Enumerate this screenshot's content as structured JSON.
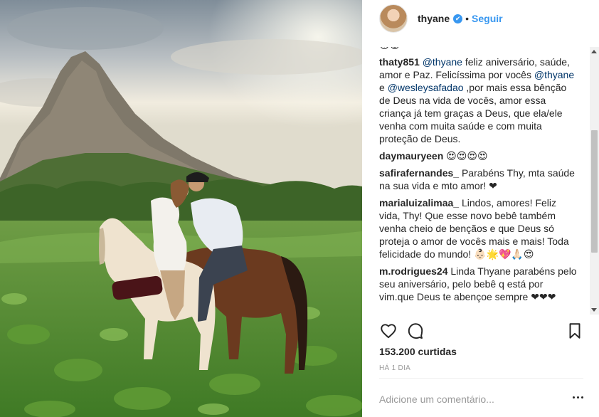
{
  "post": {
    "username": "thyane",
    "follow_label": "Seguir",
    "separator": "•",
    "verified_icon": "✔"
  },
  "comments": [
    {
      "type": "emoji",
      "text": "😘😍"
    },
    {
      "type": "comment",
      "user": "thaty851",
      "parts": [
        {
          "mention": "@thyane"
        },
        {
          "text": " feliz aniversário, saúde, amor e Paz. Felicíssima por vocês "
        },
        {
          "mention": "@thyane"
        },
        {
          "text": " e "
        },
        {
          "mention": "@wesleysafadao"
        },
        {
          "text": " ,por mais essa bênção de Deus na vida de vocês, amor essa criança já tem graças a Deus, que ela/ele venha com muita saúde e com muita proteção de Deus."
        }
      ]
    },
    {
      "type": "comment",
      "user": "daymauryeen",
      "parts": [
        {
          "text": "😍😍😍😍"
        }
      ]
    },
    {
      "type": "comment",
      "user": "safirafernandes_",
      "parts": [
        {
          "text": "Parabéns Thy, mta saúde na sua vida e mto amor! ❤"
        }
      ]
    },
    {
      "type": "comment",
      "user": "marialuizalimaa_",
      "parts": [
        {
          "text": "Lindos, amores! Feliz vida, Thy! Que esse novo bebê também venha cheio de bençãos e que Deus só proteja o amor de vocês mais e mais! Toda felicidade do mundo! 👶🏻🌟💖🙏🏻😍"
        }
      ]
    },
    {
      "type": "comment",
      "user": "m.rodrigues24",
      "parts": [
        {
          "text": "Linda Thyane parabéns pelo seu aniversário, pelo bebê q está por vim.que Deus te abençoe sempre ❤❤❤"
        }
      ]
    }
  ],
  "stats": {
    "likes": "153.200 curtidas",
    "time": "HÁ 1 DIA"
  },
  "composer": {
    "placeholder": "Adicione um comentário..."
  },
  "icons": {
    "like": "heart-icon",
    "comment": "comment-bubble-icon",
    "save": "bookmark-icon",
    "more": "more-options-icon"
  }
}
